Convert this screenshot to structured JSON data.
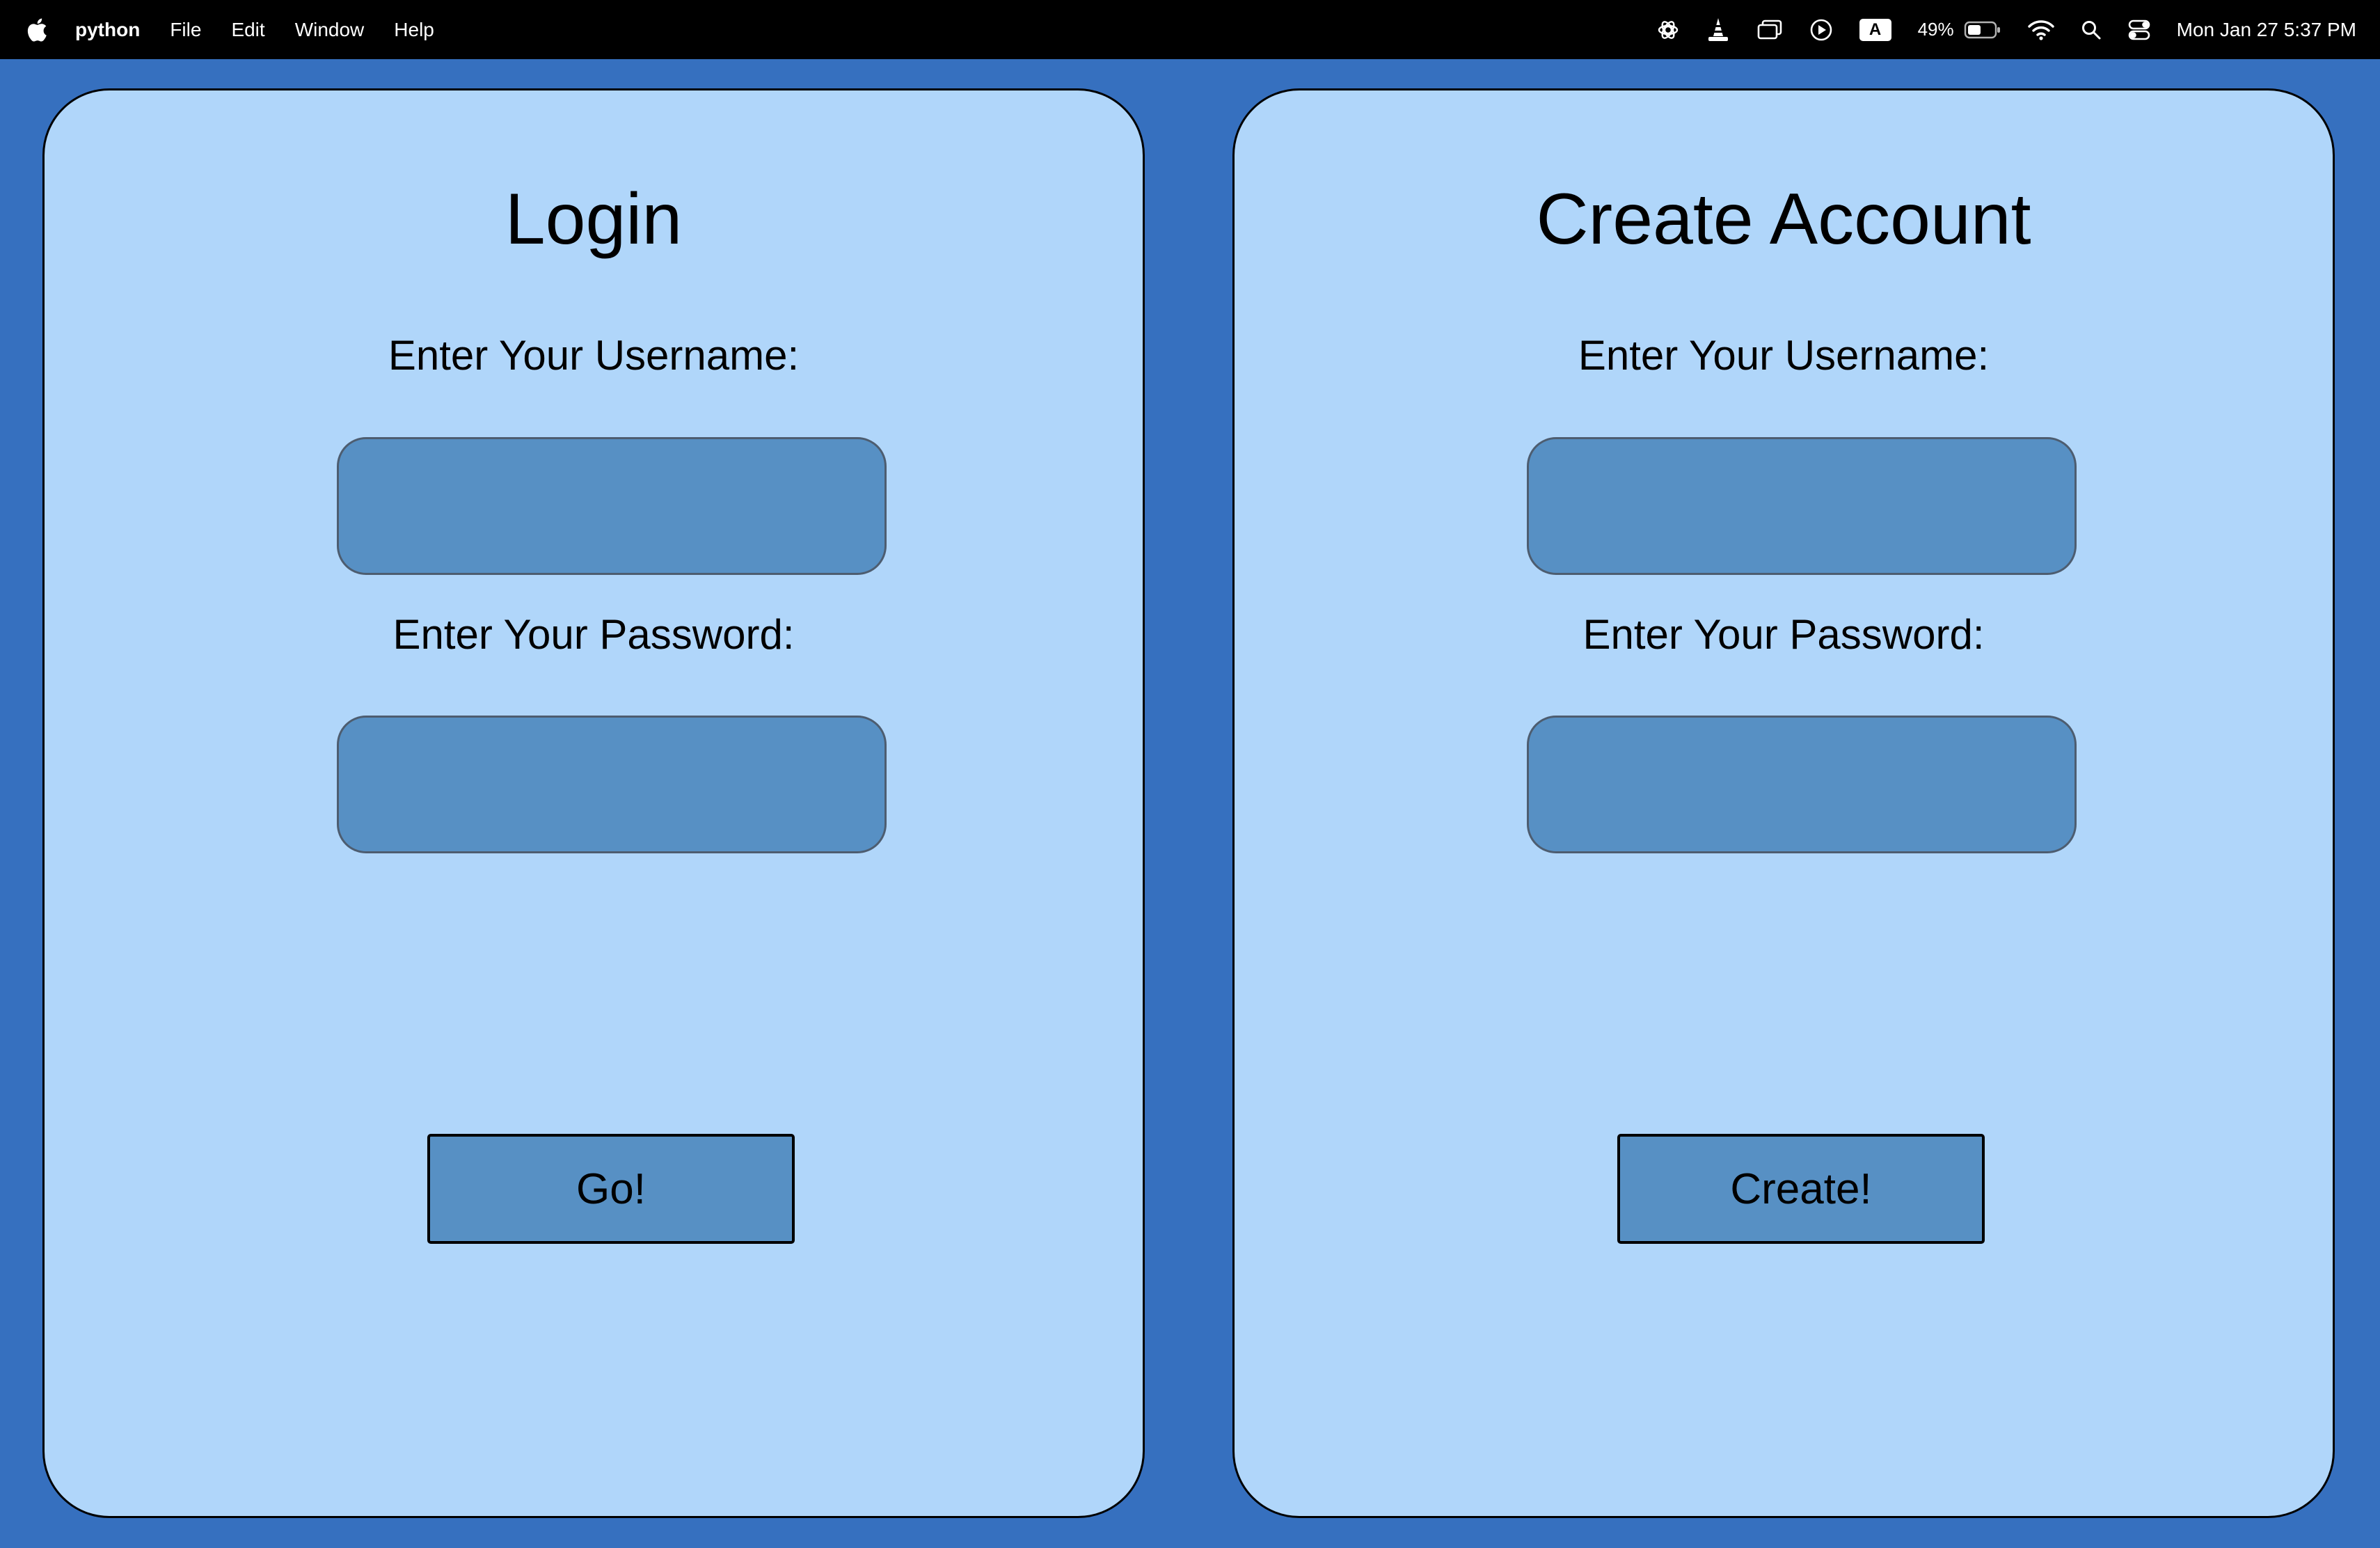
{
  "menubar": {
    "app_name": "python",
    "items": [
      "File",
      "Edit",
      "Window",
      "Help"
    ],
    "status": {
      "icons": [
        "chatgpt-icon",
        "vlc-cone-icon",
        "screen-mirror-icon",
        "play-circle-icon",
        "keyboard-input-icon",
        "battery-icon",
        "wifi-icon",
        "spotlight-search-icon",
        "control-center-icon"
      ],
      "input_source": "A",
      "battery_percent": "49%",
      "datetime": "Mon Jan 27  5:37 PM"
    }
  },
  "colors": {
    "desktop_bg": "#3670bf",
    "panel_bg": "#b0d6fa",
    "field_bg": "#5790c4",
    "menubar_bg": "#000000"
  },
  "login": {
    "title": "Login",
    "username_label": "Enter Your Username:",
    "username_value": "",
    "password_label": "Enter Your Password:",
    "password_value": "",
    "button_label": "Go!"
  },
  "create": {
    "title": "Create Account",
    "username_label": "Enter Your Username:",
    "username_value": "",
    "password_label": "Enter Your Password:",
    "password_value": "",
    "button_label": "Create!"
  }
}
